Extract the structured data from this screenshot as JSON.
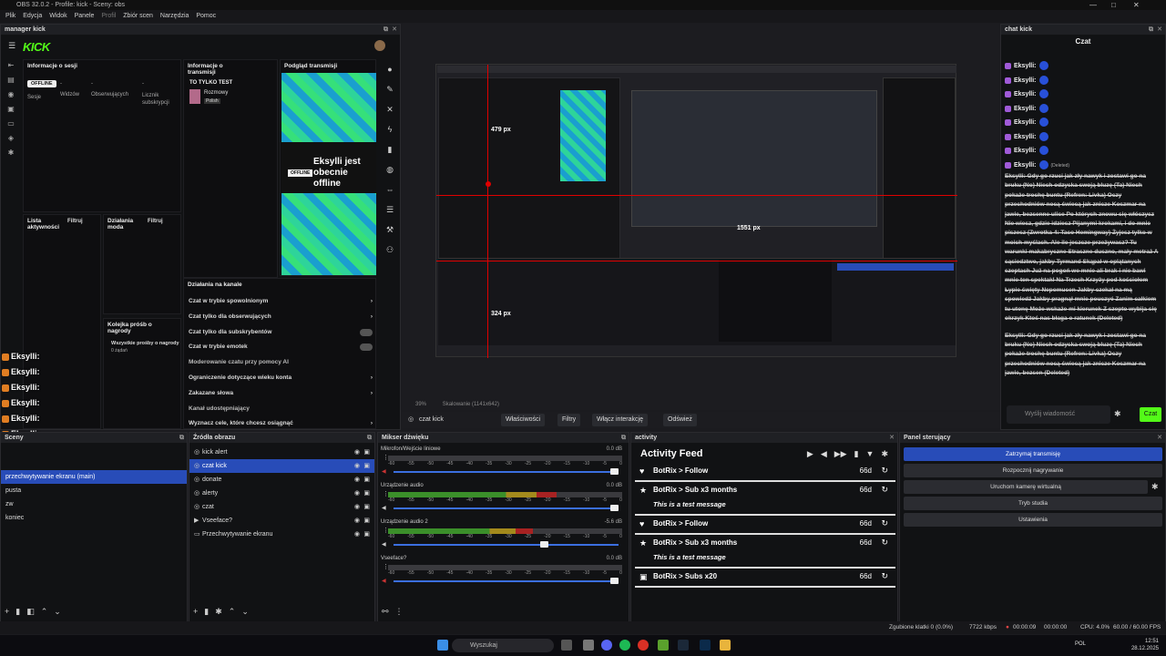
{
  "window": {
    "title": "OBS 32.0.2 - Profile: kick - Sceny: obs",
    "controls": [
      "—",
      "□",
      "✕"
    ]
  },
  "menu": [
    "Plik",
    "Edycja",
    "Widok",
    "Panele",
    "Profil",
    "Zbiór scen",
    "Narzędzia",
    "Pomoc"
  ],
  "kick": {
    "dock_title": "manager kick",
    "logo": "KICK",
    "session": {
      "title": "Informacje o sesji",
      "status": "OFFLINE",
      "stats": [
        {
          "value": "-",
          "label": "Sesje"
        },
        {
          "value": "-",
          "label": "Widzów"
        },
        {
          "value": "-",
          "label": "Obserwujących"
        },
        {
          "value": "-",
          "label": "Licznik subskrypcji"
        }
      ]
    },
    "stream_info": {
      "title": "Informacje o transmisji",
      "stream_title": "TO TYLKO TEST",
      "category": "Rozmowy",
      "language": "Polish"
    },
    "preview": {
      "title": "Podgląd transmisji",
      "badge": "OFFLINE",
      "text": "Eksylli jest obecnie offline"
    },
    "activity_list": {
      "title": "Lista aktywności",
      "filter": "Filtruj"
    },
    "mod_actions": {
      "title": "Działania moda",
      "filter": "Filtruj"
    },
    "rewards": {
      "title": "Kolejka próśb o nagrody",
      "text": "Wszystkie prośby o nagrody",
      "count": "0 żądań"
    },
    "channel": {
      "title": "Działania na kanale",
      "options": [
        {
          "label": "Czat w trybie spowolnionym",
          "kind": "arrow"
        },
        {
          "label": "Czat tylko dla obserwujących",
          "kind": "arrow"
        },
        {
          "label": "Czat tylko dla subskrybentów",
          "kind": "toggle"
        },
        {
          "label": "Czat w trybie emotek",
          "kind": "toggle"
        },
        {
          "label": "Moderowanie czatu przy pomocy AI",
          "kind": "none"
        },
        {
          "label": "Ograniczenie dotyczące wieku konta",
          "kind": "arrow"
        },
        {
          "label": "Zakazane słowa",
          "kind": "arrow"
        },
        {
          "label": "Kanał udostępniający",
          "kind": "none"
        },
        {
          "label": "Wyznacz cele, które chcesz osiągnąć",
          "kind": "arrow"
        }
      ]
    }
  },
  "overlay_names": [
    "Eksylli:",
    "Eksylli:",
    "Eksylli:",
    "Eksylli:",
    "Eksylli:",
    "Eksylli:",
    "Eksylli:"
  ],
  "preview_bar": {
    "zoom": "39%",
    "scale": "Skalowanie (1141x642)"
  },
  "canvas_labels": {
    "h1": "479 px",
    "h2": "324 px",
    "w": "1551 px"
  },
  "source_bar": {
    "name": "czat kick",
    "buttons": [
      "Właściwości",
      "Filtry",
      "Włącz interakcję",
      "Odśwież"
    ]
  },
  "chat": {
    "dock_title": "chat kick",
    "header": "Czat",
    "names": [
      "Eksylli:",
      "Eksylli:",
      "Eksylli:",
      "Eksylli:",
      "Eksylli:",
      "Eksylli:",
      "Eksylli:",
      "Eksylli:"
    ],
    "deleted_tag": "(Deleted)",
    "message1": "Eksylli: Gdy go rzuci jak zły nawyk i zostawi go na bruku (No) Niech odzyska swoją bluzę (Ta) Niech pokaże trochę buntu (Refren: Livka) Oczy przechodniów nocą świecą jak znicze Koszmar na jawie, bezsenne ulice Po których znowu się włóczysz Nie wiesz, gdzie idziesz Pijanymi krokami, i do mnie piszesz (Zwrotka 4: Taco Hemingway) Żyjesz tylko w moich myślach. Ale ile jeszcze przeżywasz? Tu warunki makabryczne Straszne duszno, mały metraż A sąsiedztwo, jakby Tyrmand Skąpał w oplątanych szeptach Już na pogoń we mnie ali brak i nie bawi mnie ten spektakl Na Trzech Krzyży pod kościołem Łypie święty Nepomucen Jakby czekał na mą spowiedź Jakby pragnął mnie pouczyć Zanim całkiem tu utonę Może wskaże mi kierunek Z szepto wybija się okrzyk Ktoś nas błaga o ratunek (Deleted)",
    "message2": "Eksylli: Gdy go rzuci jak zły nawyk i zostawi go na bruku (No) Niech odzyska swoją bluzę (Ta) Niech pokaże trochę buntu (Refren: Livka) Oczy przechodniów nocą świecą jak znicze Koszmar na jawie, bezsen (Deleted)",
    "input_placeholder": "Wyślij wiadomość",
    "send": "Czat"
  },
  "scenes": {
    "title": "Sceny",
    "items": [
      "przechwytywanie ekranu (main)",
      "pusta",
      "zw",
      "koniec"
    ],
    "selected": 0
  },
  "sources": {
    "title": "Źródła obrazu",
    "items": [
      {
        "name": "kick alert",
        "icon": "◎"
      },
      {
        "name": "czat kick",
        "icon": "◎"
      },
      {
        "name": "donate",
        "icon": "◎"
      },
      {
        "name": "alerty",
        "icon": "◎"
      },
      {
        "name": "czat",
        "icon": "◎"
      },
      {
        "name": "Vseeface?",
        "icon": "▶"
      },
      {
        "name": "Przechwytywanie ekranu",
        "icon": "▭"
      }
    ],
    "selected": 1
  },
  "mixer": {
    "title": "Mikser dźwięku",
    "ticks": [
      "-60",
      "-55",
      "-50",
      "-45",
      "-40",
      "-35",
      "-30",
      "-25",
      "-20",
      "-15",
      "-10",
      "-5",
      "0"
    ],
    "channels": [
      {
        "name": "Mikrofon/Wejście liniowe",
        "db": "0.0 dB",
        "level": 0,
        "volume": 1.0
      },
      {
        "name": "Urządzenie audio",
        "db": "0.0 dB",
        "level": 0.72,
        "volume": 1.0
      },
      {
        "name": "Urządzenie audio 2",
        "db": "-5.6 dB",
        "level": 0.62,
        "volume": 0.69
      },
      {
        "name": "Vseeface?",
        "db": "0.0 dB",
        "level": 0,
        "volume": 1.0
      }
    ]
  },
  "activity": {
    "dock_title": "activity",
    "title": "Activity Feed",
    "items": [
      {
        "icon": "♥",
        "title": "BotRix > Follow",
        "age": "66d",
        "message": ""
      },
      {
        "icon": "★",
        "title": "BotRix > Sub x3 months",
        "age": "66d",
        "message": "This is a test message"
      },
      {
        "icon": "♥",
        "title": "BotRix > Follow",
        "age": "66d",
        "message": ""
      },
      {
        "icon": "★",
        "title": "BotRix > Sub x3 months",
        "age": "66d",
        "message": "This is a test message"
      },
      {
        "icon": "▣",
        "title": "BotRix > Subs x20",
        "age": "66d",
        "message": ""
      }
    ]
  },
  "controls": {
    "title": "Panel sterujący",
    "buttons": [
      "Zatrzymaj transmisję",
      "Rozpocznij nagrywanie",
      "Uruchom kamerę wirtualną",
      "Tryb studia",
      "Ustawienia"
    ]
  },
  "status": {
    "dropped": "Zgubione klatki 0 (0.0%)",
    "bitrate": "7722 kbps",
    "stream_time": "00:00:09",
    "rec_time": "00:00:00",
    "cpu": "CPU: 4.0%",
    "fps": "60.00 / 60.00 FPS"
  },
  "taskbar": {
    "search": "Wyszukaj",
    "lang": "POL",
    "time": "12:51",
    "date": "28.12.2025"
  },
  "colors": {
    "kick_green": "#53fc18",
    "accent_blue": "#284cb8",
    "guide_red": "#e00000"
  }
}
